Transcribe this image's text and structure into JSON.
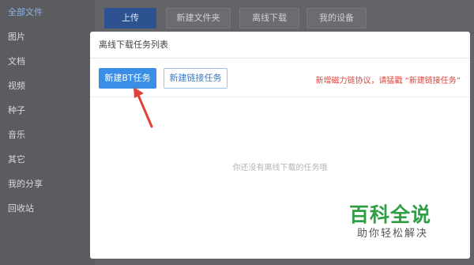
{
  "sidebar": {
    "items": [
      {
        "label": "全部文件"
      },
      {
        "label": "图片"
      },
      {
        "label": "文档"
      },
      {
        "label": "视频"
      },
      {
        "label": "种子"
      },
      {
        "label": "音乐"
      },
      {
        "label": "其它"
      },
      {
        "label": "我的分享"
      },
      {
        "label": "回收站"
      }
    ]
  },
  "toolbar": {
    "upload_label": "上传",
    "new_folder_label": "新建文件夹",
    "offline_download_label": "离线下载",
    "my_devices_label": "我的设备"
  },
  "modal": {
    "title": "离线下载任务列表",
    "new_bt_task_label": "新建BT任务",
    "new_link_task_label": "新建链接任务",
    "hint_text": "新增磁力链协议，请猛戳 “新建链接任务”",
    "empty_text": "你还没有离线下载的任务哦"
  },
  "watermark": {
    "title": "百科全说",
    "subtitle": "助你轻松解决"
  },
  "colors": {
    "primary": "#3a8ee6",
    "hint": "#e0413a",
    "arrow": "#e0413a",
    "watermark_green": "#2f9e44"
  }
}
